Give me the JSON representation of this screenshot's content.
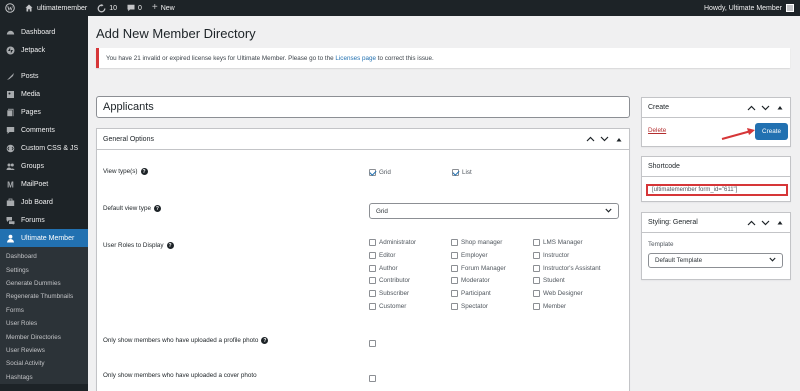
{
  "adminbar": {
    "site_name": "ultimatemember",
    "updates_count": "10",
    "comments_count": "0",
    "new_label": "New",
    "howdy": "Howdy, Ultimate Member"
  },
  "sidebar": {
    "items": [
      {
        "label": "Dashboard",
        "icon": "dashboard-icon"
      },
      {
        "label": "Jetpack",
        "icon": "jetpack-icon"
      },
      {
        "label": "Posts",
        "icon": "posts-icon"
      },
      {
        "label": "Media",
        "icon": "media-icon"
      },
      {
        "label": "Pages",
        "icon": "pages-icon"
      },
      {
        "label": "Comments",
        "icon": "comments-icon"
      },
      {
        "label": "Custom CSS & JS",
        "icon": "code-icon"
      },
      {
        "label": "Groups",
        "icon": "groups-icon"
      },
      {
        "label": "MailPoet",
        "icon": "mailpoet-icon"
      },
      {
        "label": "Job Board",
        "icon": "job-board-icon"
      },
      {
        "label": "Forums",
        "icon": "forums-icon"
      },
      {
        "label": "Ultimate Member",
        "icon": "ultimate-member-icon"
      }
    ],
    "submenu": [
      "Dashboard",
      "Settings",
      "Generate Dummies",
      "Regenerate Thumbnails",
      "Forms",
      "User Roles",
      "Member Directories",
      "User Reviews",
      "Social Activity",
      "Hashtags"
    ]
  },
  "page": {
    "title": "Add New Member Directory",
    "notice_before": "You have 21 invalid or expired license keys for Ultimate Member. Please go to the ",
    "notice_link": "Licenses page",
    "notice_after": " to correct this issue.",
    "directory_title": "Applicants"
  },
  "general_options": {
    "header": "General Options",
    "view_types_label": "View type(s)",
    "view_types": [
      {
        "label": "Grid",
        "checked": true
      },
      {
        "label": "List",
        "checked": true
      }
    ],
    "default_view_label": "Default view type",
    "default_view_value": "Grid",
    "roles_label": "User Roles to Display",
    "roles": [
      [
        "Administrator",
        "Shop manager",
        "LMS Manager"
      ],
      [
        "Editor",
        "Employer",
        "Instructor"
      ],
      [
        "Author",
        "Forum Manager",
        "Instructor's Assistant"
      ],
      [
        "Contributor",
        "Moderator",
        "Student"
      ],
      [
        "Subscriber",
        "Participant",
        "Web Designer"
      ],
      [
        "Customer",
        "Spectator",
        "Member"
      ]
    ],
    "profile_photo_label": "Only show members who have uploaded a profile photo",
    "cover_photo_label": "Only show members who have uploaded a cover photo"
  },
  "create_box": {
    "header": "Create",
    "delete_label": "Delete",
    "create_label": "Create"
  },
  "shortcode_box": {
    "header": "Shortcode",
    "value": "[ultimatemember form_id=\"611\"]"
  },
  "styling_box": {
    "header": "Styling: General",
    "template_label": "Template",
    "template_value": "Default Template"
  },
  "colors": {
    "accent": "#2271b1",
    "error": "#d63638",
    "sidebar_bg": "#1d2327",
    "submenu_bg": "#2c3338"
  }
}
